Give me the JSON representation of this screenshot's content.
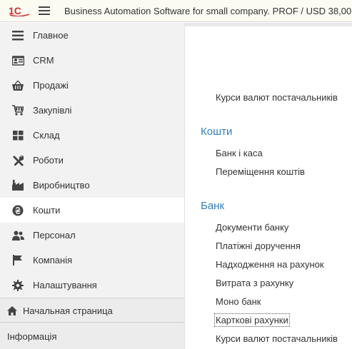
{
  "window": {
    "title": "Business Automation Software for small company. PROF / USD 38,00"
  },
  "colors": {
    "accent": "#2f7fbf",
    "logo_red": "#d32f2f",
    "sidebar_bg": "#f2f2f2",
    "active_bg": "#ffffff"
  },
  "sidebar": {
    "items": [
      {
        "label": "Главное",
        "icon": "list-icon"
      },
      {
        "label": "CRM",
        "icon": "contact-card-icon"
      },
      {
        "label": "Продажі",
        "icon": "basket-icon"
      },
      {
        "label": "Закупівлі",
        "icon": "cart-icon"
      },
      {
        "label": "Склад",
        "icon": "grid-icon"
      },
      {
        "label": "Роботи",
        "icon": "tools-icon"
      },
      {
        "label": "Виробництво",
        "icon": "factory-icon"
      },
      {
        "label": "Кошти",
        "icon": "hryvnia-coin-icon",
        "active": true
      },
      {
        "label": "Персонал",
        "icon": "people-icon"
      },
      {
        "label": "Компанія",
        "icon": "flag-icon"
      },
      {
        "label": "Налаштування",
        "icon": "gear-icon"
      }
    ],
    "home_label": "Начальная страница",
    "info_label": "Інформація"
  },
  "content": {
    "top_link": "Курси валют постачальників",
    "sections": [
      {
        "title": "Кошти",
        "links": [
          "Банк і каса",
          "Переміщення коштів"
        ]
      },
      {
        "title": "Банк",
        "links": [
          "Документи банку",
          "Платіжні доручення",
          "Надходження на рахунок",
          "Витрата з рахунку",
          "Моно банк",
          "Карткові рахунки",
          "Курси валют постачальників"
        ]
      }
    ]
  }
}
